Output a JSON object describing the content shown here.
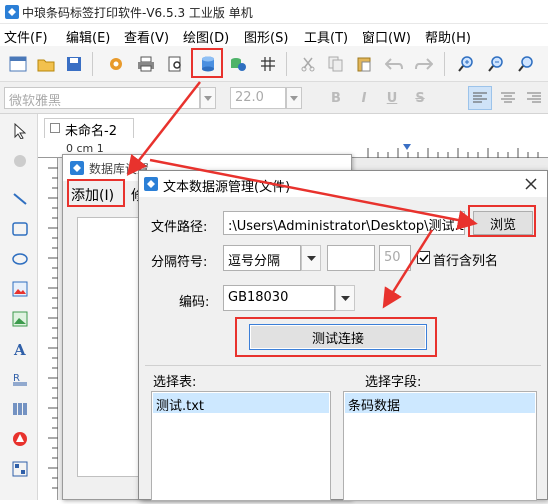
{
  "window": {
    "title": "中琅条码标签打印软件-V6.5.3 工业版 单机"
  },
  "menu": [
    "文件(F)",
    "编辑(E)",
    "查看(V)",
    "绘图(D)",
    "图形(S)",
    "工具(T)",
    "窗口(W)",
    "帮助(H)"
  ],
  "format_bar": {
    "font_name": "微软雅黑",
    "font_size": "22.0",
    "bold": "B",
    "italic": "I",
    "underline": "U",
    "strike": "S"
  },
  "document": {
    "tab_label": "未命名-2",
    "ruler_text": "0 cm 1"
  },
  "db_dialog": {
    "title": "数据库设置",
    "add_label": "添加(I)",
    "edit_label": "修"
  },
  "text_dialog": {
    "title": "文本数据源管理(文件)",
    "file_path_label": "文件路径:",
    "file_path_value": ":\\Users\\Administrator\\Desktop\\测试.txt",
    "browse_label": "浏览",
    "separator_label": "分隔符号:",
    "separator_value": "逗号分隔",
    "separator_count": "50",
    "header_checkbox_label": "首行含列名",
    "header_checked": true,
    "encoding_label": "编码:",
    "encoding_value": "GB18030",
    "test_button_label": "测试连接",
    "table_label": "选择表:",
    "field_label": "选择字段:",
    "tables": [
      "测试.txt"
    ],
    "fields": [
      "条码数据"
    ]
  },
  "colors": {
    "highlight": "#e8322d",
    "selection": "#cde8ff"
  }
}
